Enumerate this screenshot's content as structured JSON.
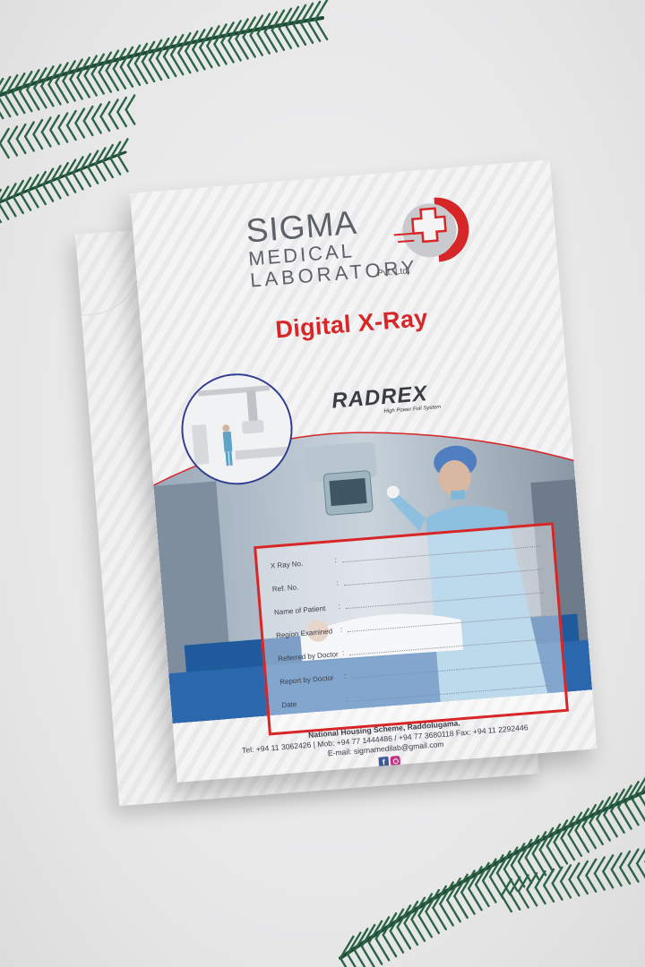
{
  "brand": {
    "line1": "SIGMA",
    "line2": "MEDICAL",
    "line3": "LABORATORY",
    "suffix": "Pvt. Ltd."
  },
  "document_title": "Digital X-Ray",
  "equipment_brand": {
    "name": "RADREX",
    "tagline": "High Power Full System"
  },
  "form_fields": [
    {
      "label": "X Ray No."
    },
    {
      "label": "Ref. No."
    },
    {
      "label": "Name of Patient"
    },
    {
      "label": "Region Examined"
    },
    {
      "label": "Referred by Doctor"
    },
    {
      "label": "Report by Doctor"
    },
    {
      "label": "Date"
    }
  ],
  "footer": {
    "address": "National Housing Scheme, Raddolugama.",
    "phones": "Tel: +94 11 3062426 | Mob: +94 77 1444486 / +94 77 3680118 Fax: +94 11 2292446",
    "email": "E-mail: sigmamedilab@gmail.com"
  },
  "icons": [
    "facebook-icon",
    "instagram-icon"
  ],
  "colors": {
    "accent_red": "#d62628",
    "navy": "#2d3c8e",
    "gray_text": "#5d6168"
  }
}
